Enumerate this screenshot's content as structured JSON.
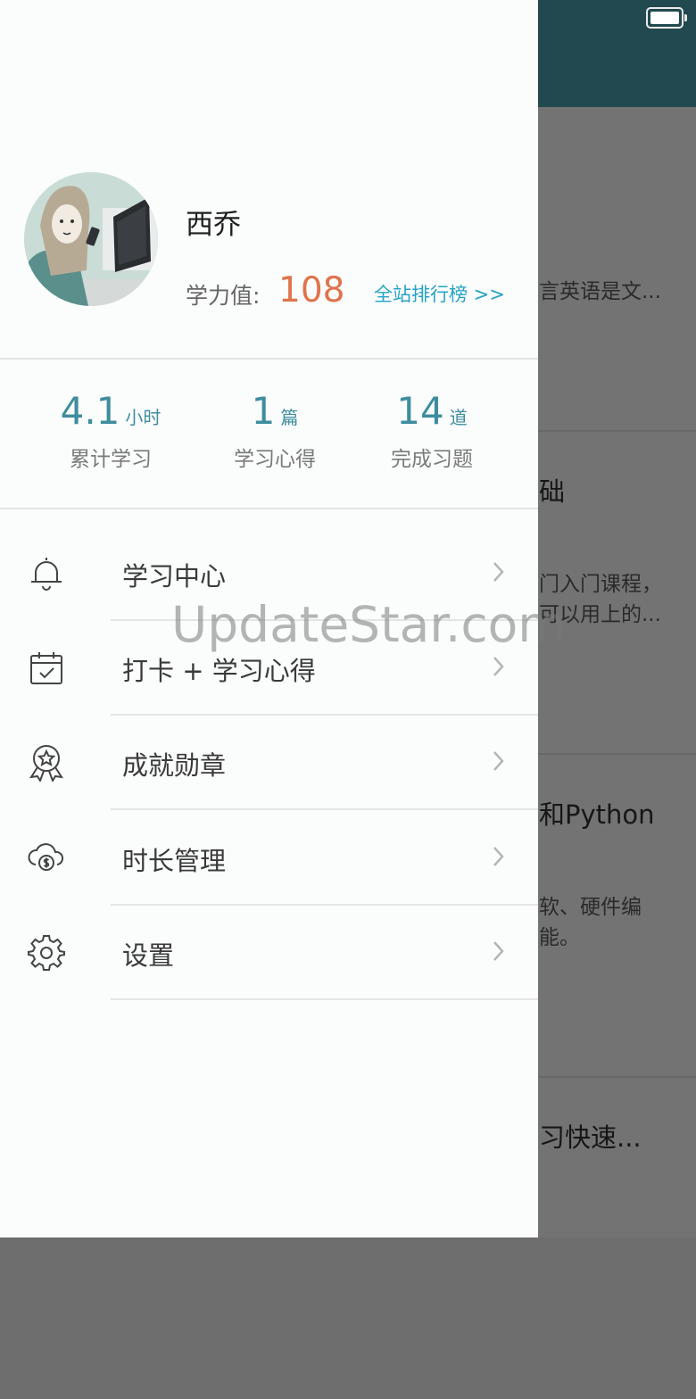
{
  "status_bar": {
    "battery_icon": "battery-icon"
  },
  "background": {
    "cards": [
      {
        "title": "",
        "desc": [
          "言英语是文..."
        ]
      },
      {
        "title": "础",
        "desc": [
          "门入门课程，",
          "可以用上的..."
        ]
      },
      {
        "title": "和Python",
        "desc": [
          "软、硬件编",
          "能。"
        ]
      },
      {
        "title": "习快速...",
        "desc": []
      }
    ]
  },
  "profile": {
    "name": "西乔",
    "score_label": "学力值:",
    "score_value": "108",
    "rank_link": "全站排行榜 >>"
  },
  "stats": [
    {
      "value": "4.1",
      "unit": "小时",
      "label": "累计学习"
    },
    {
      "value": "1",
      "unit": "篇",
      "label": "学习心得"
    },
    {
      "value": "14",
      "unit": "道",
      "label": "完成习题"
    }
  ],
  "menu": [
    {
      "label": "学习中心",
      "icon": "bell-icon"
    },
    {
      "label": "打卡 + 学习心得",
      "icon": "calendar-check-icon"
    },
    {
      "label": "成就勋章",
      "icon": "medal-icon"
    },
    {
      "label": "时长管理",
      "icon": "cloud-coin-icon"
    },
    {
      "label": "设置",
      "icon": "gear-icon"
    }
  ],
  "watermark": "UpdateStar.com",
  "colors": {
    "accent": "#3e8d9e",
    "score": "#e0734b",
    "link": "#24a3c6",
    "header": "#22494f"
  }
}
